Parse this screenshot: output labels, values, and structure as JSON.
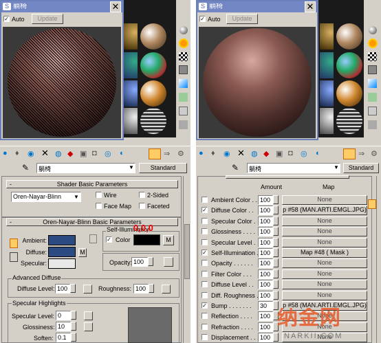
{
  "left": {
    "title": "躺椅",
    "auto_label": "Auto",
    "update_label": "Update",
    "material_name": "躺椅",
    "type_button": "Standard",
    "shader_section": "Shader Basic Parameters",
    "shader_type": "Oren-Nayar-Blinn",
    "wire": "Wire",
    "two_sided": "2-Sided",
    "face_map": "Face Map",
    "faceted": "Faceted",
    "onb_section": "Oren-Nayar-Blinn Basic Parameters",
    "self_illum_group": "Self-Illumination",
    "color_label": "Color",
    "m": "M",
    "ambient": "Ambient:",
    "diffuse": "Diffuse:",
    "specular": "Specular:",
    "opacity_label": "Opacity:",
    "opacity_value": "100",
    "advanced_group": "Advanced Diffuse",
    "diffuse_level_label": "Diffuse Level:",
    "diffuse_level_value": "100",
    "roughness_label": "Roughness:",
    "roughness_value": "100",
    "spec_group": "Specular Highlights",
    "spec_level_label": "Specular Level:",
    "spec_level_value": "0",
    "glossiness_label": "Glossiness:",
    "glossiness_value": "10",
    "soften_label": "Soften:",
    "soften_value": "0.1",
    "annotation": "0,0,0"
  },
  "right": {
    "title": "躺椅",
    "auto_label": "Auto",
    "update_label": "Update",
    "material_name": "躺椅",
    "type_button": "Standard",
    "col_amount": "Amount",
    "col_map": "Map",
    "maps": [
      {
        "name": "Ambient Color . .",
        "amount": "100",
        "map": "None",
        "checked": false
      },
      {
        "name": "Diffuse Color . .",
        "amount": "100",
        "map": "p #58 (MAN.ARTI.EMGL.JPG)",
        "checked": true
      },
      {
        "name": "Specular Color .",
        "amount": "100",
        "map": "None",
        "checked": false
      },
      {
        "name": "Glossiness . . . .",
        "amount": "100",
        "map": "None",
        "checked": false
      },
      {
        "name": "Specular Level .",
        "amount": "100",
        "map": "None",
        "checked": false
      },
      {
        "name": "Self-Illumination .",
        "amount": "100",
        "map": "Map #48  ( Mask )",
        "checked": true
      },
      {
        "name": "Opacity . . . . . .",
        "amount": "100",
        "map": "None",
        "checked": false
      },
      {
        "name": "Filter Color . . .",
        "amount": "100",
        "map": "None",
        "checked": false
      },
      {
        "name": "Diffuse Level . .",
        "amount": "100",
        "map": "None",
        "checked": false
      },
      {
        "name": "Diff. Roughness .",
        "amount": "100",
        "map": "None",
        "checked": false
      },
      {
        "name": "Bump . . . . . . .",
        "amount": "30",
        "map": "p #58 (MAN.ARTI.EMGL.JPG)",
        "checked": true
      },
      {
        "name": "Reflection . . . .",
        "amount": "100",
        "map": "None",
        "checked": false
      },
      {
        "name": "Refraction . . . .",
        "amount": "100",
        "map": "None",
        "checked": false
      },
      {
        "name": "Displacement . . .",
        "amount": "100",
        "map": "None",
        "checked": false
      }
    ]
  },
  "watermark": {
    "main": "纳金网",
    "sub": "NARKII.COM"
  }
}
